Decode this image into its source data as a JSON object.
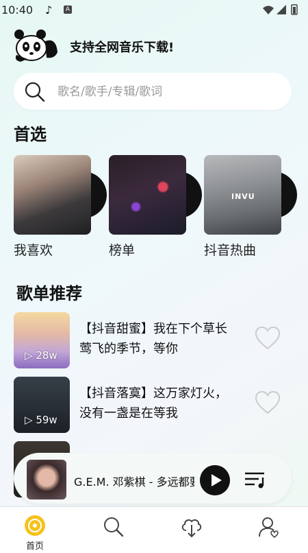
{
  "status_bar": {
    "time": "10:40"
  },
  "header": {
    "slogan": "支持全网音乐下载!"
  },
  "search": {
    "placeholder": "歌名/歌手/专辑/歌词"
  },
  "picks": {
    "title": "首选",
    "items": [
      {
        "label": "我喜欢"
      },
      {
        "label": "榜单"
      },
      {
        "label": "抖音热曲",
        "cover_text": "INVU"
      }
    ]
  },
  "playlists": {
    "title": "歌单推荐",
    "items": [
      {
        "title": "【抖音甜蜜】我在下个草长莺飞的季节，等你",
        "plays": "28w"
      },
      {
        "title": "【抖音落寞】这万家灯火，没有一盏是在等我",
        "plays": "59w"
      }
    ]
  },
  "player": {
    "song": "G.E.M. 邓紫棋 - 多远都要在一起"
  },
  "tabbar": {
    "home": "首页"
  },
  "colors": {
    "accent": "#f5c21b",
    "background": "#eef8f6"
  }
}
